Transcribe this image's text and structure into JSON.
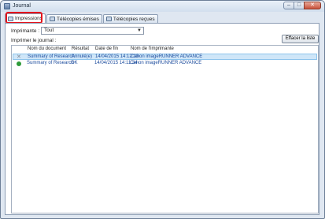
{
  "window": {
    "title": "Journal",
    "controls": {
      "minimize": "–",
      "maximize": "□",
      "close": "✕"
    }
  },
  "tabs": [
    {
      "label": "Impressions",
      "icon": "printer-icon",
      "active": true
    },
    {
      "label": "Télécopies émises",
      "icon": "fax-sent-icon",
      "active": false
    },
    {
      "label": "Télécopies reçues",
      "icon": "fax-received-icon",
      "active": false
    }
  ],
  "filter": {
    "label": "Imprimante :",
    "selected": "Tout"
  },
  "journal": {
    "label": "Imprimer le journal :",
    "clear_button": "Effacer la liste"
  },
  "table": {
    "columns": [
      "Nom du document",
      "Résultat",
      "Date de fin",
      "Nom de l'imprimante"
    ],
    "rows": [
      {
        "status_icon": "x-icon",
        "document": "Summary of Research",
        "result": "Annulé(e)",
        "end_date": "14/04/2015 14:12:10",
        "printer": "Canon imageRUNNER ADVANCE"
      },
      {
        "status_icon": "ok-icon",
        "document": "Summary of Research",
        "result": "OK",
        "end_date": "14/04/2015 14:11:34",
        "printer": "Canon imageRUNNER ADVANCE"
      }
    ]
  },
  "colors": {
    "highlight": "#e4141c",
    "selection": "#cfe6f8",
    "success": "#2e9b3a"
  }
}
